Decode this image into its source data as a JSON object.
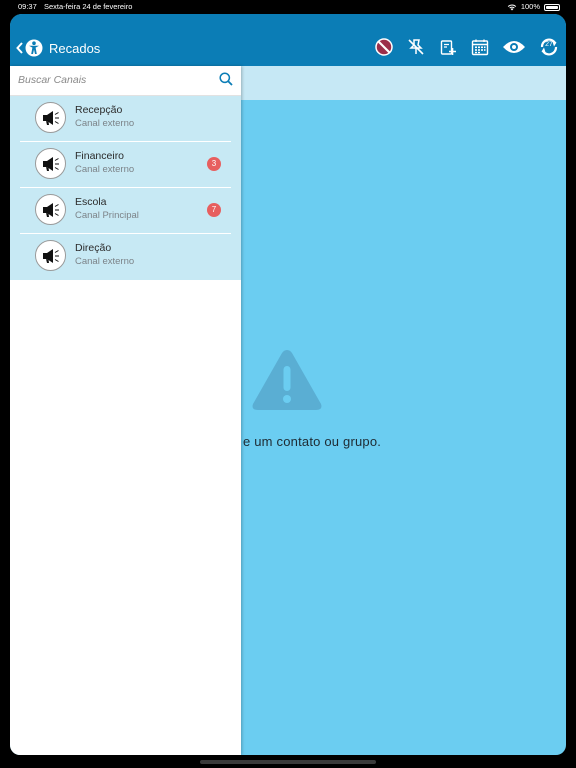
{
  "status_bar": {
    "time": "09:37",
    "date": "Sexta-feira 24 de fevereiro",
    "battery": "100%"
  },
  "header": {
    "title": "Recados",
    "icons": [
      "no-messages-icon",
      "unpin-icon",
      "add-note-icon",
      "calendar-icon",
      "eye-icon",
      "refresh-icon"
    ],
    "refresh_badge": "27"
  },
  "search": {
    "placeholder": "Buscar Canais",
    "value": ""
  },
  "channels": [
    {
      "name": "Recepção",
      "type": "Canal externo",
      "unread": ""
    },
    {
      "name": "Financeiro",
      "type": "Canal externo",
      "unread": "3"
    },
    {
      "name": "Escola",
      "type": "Canal Principal",
      "unread": "7"
    },
    {
      "name": "Direção",
      "type": "Canal externo",
      "unread": ""
    }
  ],
  "empty_state": {
    "message": "e um contato ou grupo."
  },
  "colors": {
    "navbar": "#0b7db6",
    "content_bg": "#6bcdf1",
    "list_bg": "#c7e9f4",
    "badge": "#e75f5f"
  }
}
